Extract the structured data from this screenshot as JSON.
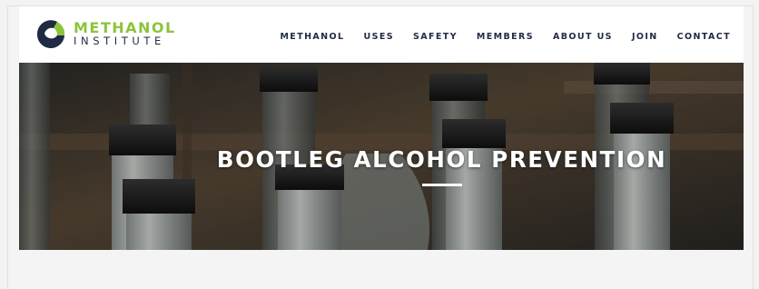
{
  "brand": {
    "name_top": "METHANOL",
    "name_bottom": "INSTITUTE",
    "colors": {
      "green": "#8cc43c",
      "navy": "#1f2a44"
    }
  },
  "nav": {
    "items": [
      {
        "label": "METHANOL"
      },
      {
        "label": "USES"
      },
      {
        "label": "SAFETY"
      },
      {
        "label": "MEMBERS"
      },
      {
        "label": "ABOUT US"
      },
      {
        "label": "JOIN"
      },
      {
        "label": "CONTACT"
      }
    ]
  },
  "hero": {
    "title": "BOOTLEG ALCOHOL PREVENTION",
    "background": "photo of glass bottles with black caps in a wooden crate"
  }
}
